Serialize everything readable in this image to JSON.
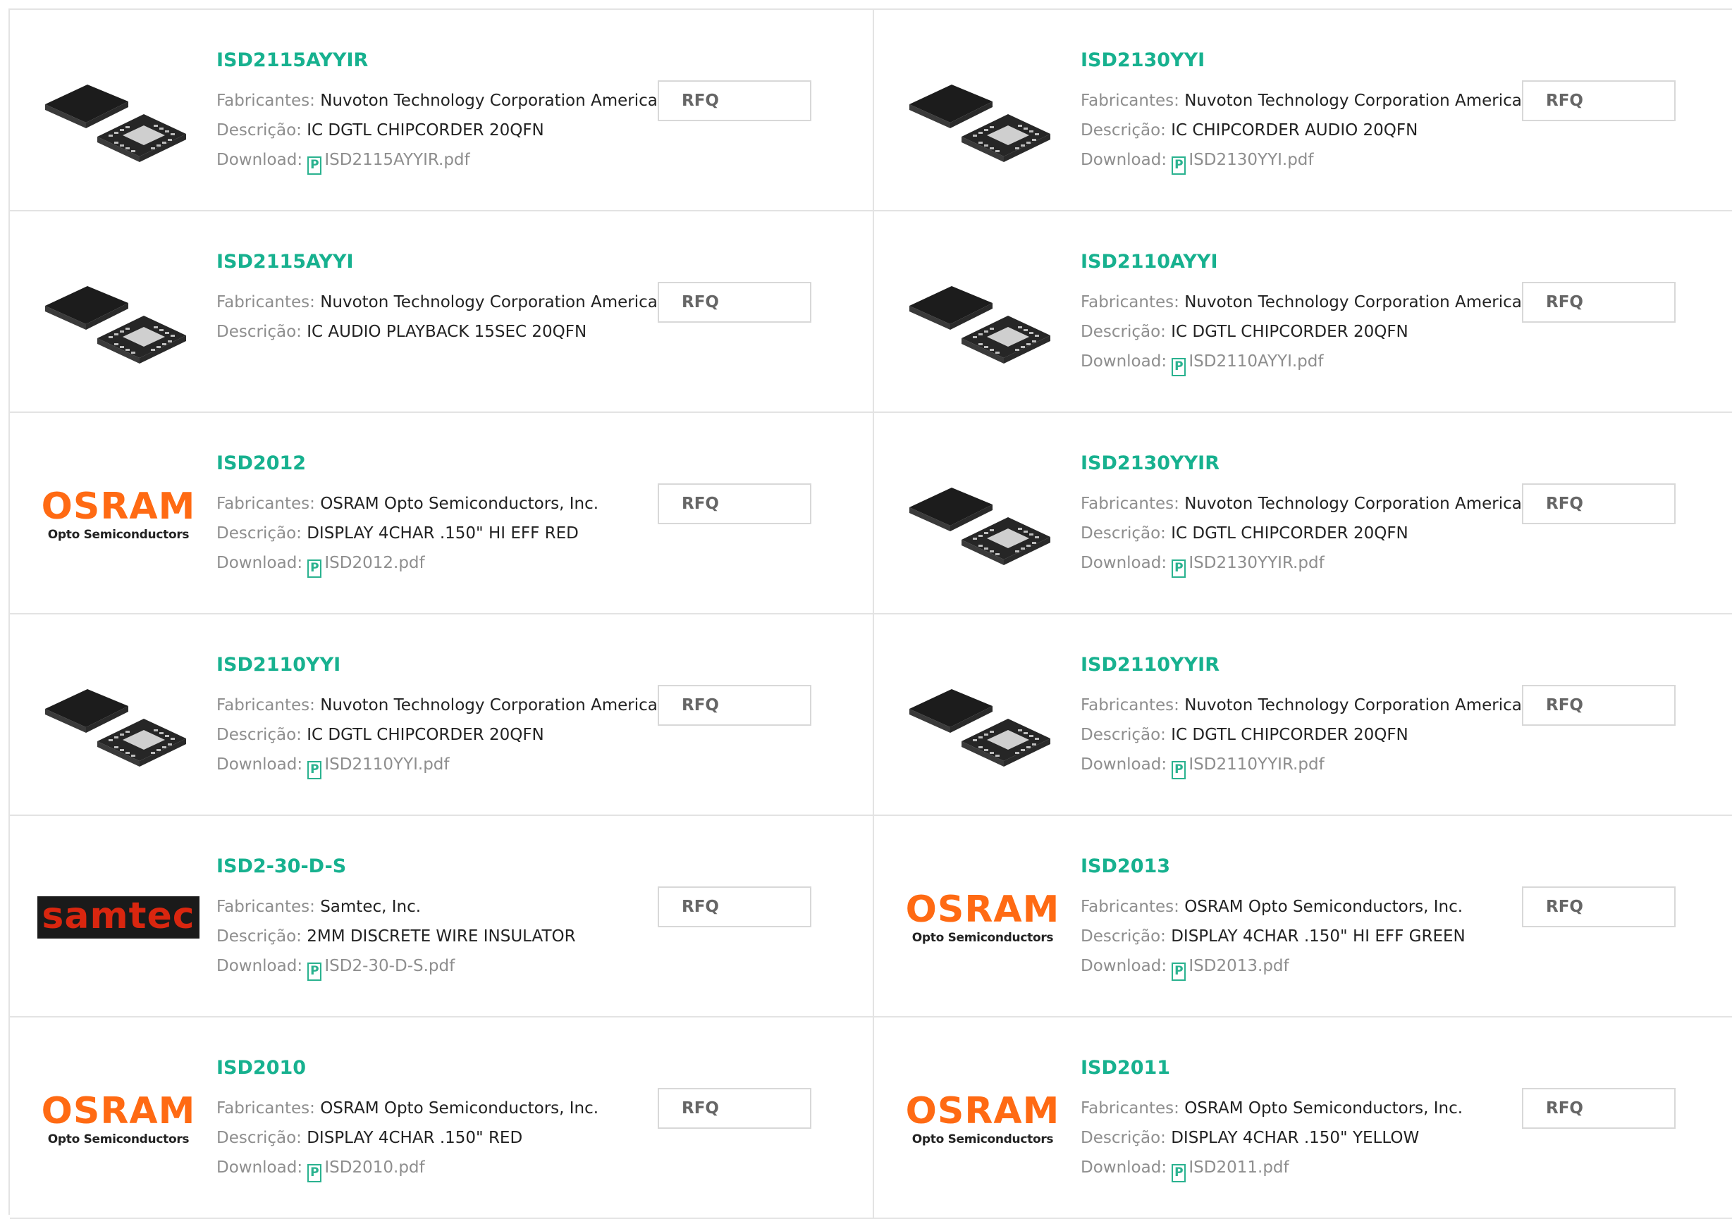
{
  "products": [
    {
      "part": "ISD2115AYYIR",
      "image": "chip",
      "manufacturer_label": "Fabricantes:",
      "manufacturer": "Nuvoton Technology Corporation America",
      "description_label": "Descrição:",
      "description": "IC DGTL CHIPCORDER 20QFN",
      "download_label": "Download:",
      "pdf": "ISD2115AYYIR.pdf",
      "rfq": "RFQ"
    },
    {
      "part": "ISD2130YYI",
      "image": "chip",
      "manufacturer_label": "Fabricantes:",
      "manufacturer": "Nuvoton Technology Corporation America",
      "description_label": "Descrição:",
      "description": "IC CHIPCORDER AUDIO 20QFN",
      "download_label": "Download:",
      "pdf": "ISD2130YYI.pdf",
      "rfq": "RFQ"
    },
    {
      "part": "ISD2115AYYI",
      "image": "chip",
      "manufacturer_label": "Fabricantes:",
      "manufacturer": "Nuvoton Technology Corporation America",
      "description_label": "Descrição:",
      "description": "IC AUDIO PLAYBACK 15SEC 20QFN",
      "rfq": "RFQ"
    },
    {
      "part": "ISD2110AYYI",
      "image": "chip",
      "manufacturer_label": "Fabricantes:",
      "manufacturer": "Nuvoton Technology Corporation America",
      "description_label": "Descrição:",
      "description": "IC DGTL CHIPCORDER 20QFN",
      "download_label": "Download:",
      "pdf": "ISD2110AYYI.pdf",
      "rfq": "RFQ"
    },
    {
      "part": "ISD2012",
      "image": "osram",
      "logo_main": "OSRAM",
      "logo_sub": "Opto Semiconductors",
      "manufacturer_label": "Fabricantes:",
      "manufacturer": "OSRAM Opto Semiconductors, Inc.",
      "description_label": "Descrição:",
      "description": "DISPLAY 4CHAR .150\" HI EFF RED",
      "download_label": "Download:",
      "pdf": "ISD2012.pdf",
      "rfq": "RFQ"
    },
    {
      "part": "ISD2130YYIR",
      "image": "chip",
      "manufacturer_label": "Fabricantes:",
      "manufacturer": "Nuvoton Technology Corporation America",
      "description_label": "Descrição:",
      "description": "IC DGTL CHIPCORDER 20QFN",
      "download_label": "Download:",
      "pdf": "ISD2130YYIR.pdf",
      "rfq": "RFQ"
    },
    {
      "part": "ISD2110YYI",
      "image": "chip",
      "manufacturer_label": "Fabricantes:",
      "manufacturer": "Nuvoton Technology Corporation America",
      "description_label": "Descrição:",
      "description": "IC DGTL CHIPCORDER 20QFN",
      "download_label": "Download:",
      "pdf": "ISD2110YYI.pdf",
      "rfq": "RFQ"
    },
    {
      "part": "ISD2110YYIR",
      "image": "chip",
      "manufacturer_label": "Fabricantes:",
      "manufacturer": "Nuvoton Technology Corporation America",
      "description_label": "Descrição:",
      "description": "IC DGTL CHIPCORDER 20QFN",
      "download_label": "Download:",
      "pdf": "ISD2110YYIR.pdf",
      "rfq": "RFQ"
    },
    {
      "part": "ISD2-30-D-S",
      "image": "samtec",
      "logo_main": "samtec",
      "manufacturer_label": "Fabricantes:",
      "manufacturer": "Samtec, Inc.",
      "description_label": "Descrição:",
      "description": "2MM DISCRETE WIRE INSULATOR",
      "download_label": "Download:",
      "pdf": "ISD2-30-D-S.pdf",
      "rfq": "RFQ"
    },
    {
      "part": "ISD2013",
      "image": "osram",
      "logo_main": "OSRAM",
      "logo_sub": "Opto Semiconductors",
      "manufacturer_label": "Fabricantes:",
      "manufacturer": "OSRAM Opto Semiconductors, Inc.",
      "description_label": "Descrição:",
      "description": "DISPLAY 4CHAR .150\" HI EFF GREEN",
      "download_label": "Download:",
      "pdf": "ISD2013.pdf",
      "rfq": "RFQ"
    },
    {
      "part": "ISD2010",
      "image": "osram",
      "logo_main": "OSRAM",
      "logo_sub": "Opto Semiconductors",
      "manufacturer_label": "Fabricantes:",
      "manufacturer": "OSRAM Opto Semiconductors, Inc.",
      "description_label": "Descrição:",
      "description": "DISPLAY 4CHAR .150\" RED",
      "download_label": "Download:",
      "pdf": "ISD2010.pdf",
      "rfq": "RFQ"
    },
    {
      "part": "ISD2011",
      "image": "osram",
      "logo_main": "OSRAM",
      "logo_sub": "Opto Semiconductors",
      "manufacturer_label": "Fabricantes:",
      "manufacturer": "OSRAM Opto Semiconductors, Inc.",
      "description_label": "Descrição:",
      "description": "DISPLAY 4CHAR .150\" YELLOW",
      "download_label": "Download:",
      "pdf": "ISD2011.pdf",
      "rfq": "RFQ"
    }
  ],
  "pdf_icon_glyph": "P",
  "colors": {
    "accent": "#17b18f",
    "label": "#8e8e8e",
    "border": "#e3e3e3",
    "osram": "#ff6a13",
    "samtec_red": "#d9260f"
  }
}
